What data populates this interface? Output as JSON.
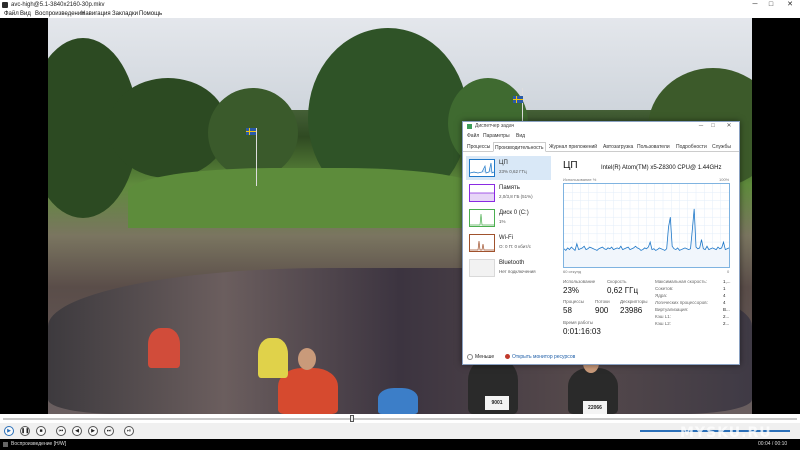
{
  "window": {
    "title": "avc-high@5.1-3840x2160-30p.mkv",
    "minimize_label": "─",
    "maximize_label": "□",
    "close_label": "✕"
  },
  "menu": {
    "items": [
      "Файл",
      "Вид",
      "Воспроизведение",
      "Навигация",
      "Закладки",
      "Помощь"
    ]
  },
  "video": {
    "bib_a": "9001",
    "bib_b": "22066"
  },
  "task_manager": {
    "title": "Диспетчер задач",
    "menu": [
      "Файл",
      "Параметры",
      "Вид"
    ],
    "tabs": [
      "Процессы",
      "Производительность",
      "Журнал приложений",
      "Автозагрузка",
      "Пользователи",
      "Подробности",
      "Службы"
    ],
    "active_tab": 1,
    "sidebar": [
      {
        "name": "ЦП",
        "sub": "23% 0,62 ГГц",
        "color": "#1f78c8"
      },
      {
        "name": "Память",
        "sub": "2,0/3,8 ГБ (51%)",
        "color": "#8a2be2"
      },
      {
        "name": "Диск 0 (C:)",
        "sub": "1%",
        "color": "#4caf50"
      },
      {
        "name": "Wi-Fi",
        "sub": "О: 0 П: 0 кбит/с",
        "color": "#a0522d"
      },
      {
        "name": "Bluetooth",
        "sub": "Нет подключения",
        "color": "#a0522d"
      }
    ],
    "cpu": {
      "heading": "ЦП",
      "model": "Intel(R) Atom(TM) x5-Z8300 CPU@ 1.44GHz",
      "util_label": "Использование %",
      "util_max": "100%",
      "time_label": "60 секунд",
      "time_zero": "0",
      "graph_color": "#1f78c8",
      "graph_values": [
        22,
        20,
        23,
        21,
        24,
        22,
        20,
        28,
        21,
        22,
        23,
        25,
        21,
        22,
        24,
        23,
        22,
        21,
        20,
        22,
        23,
        24,
        22,
        21,
        23,
        22,
        24,
        21,
        22,
        23,
        22,
        25,
        21,
        22,
        23,
        24,
        21,
        22,
        23,
        25,
        23,
        22,
        20,
        21,
        23,
        22,
        24,
        30,
        21,
        22,
        20,
        21,
        23,
        22,
        21,
        20,
        22,
        48,
        60,
        25,
        22,
        21,
        23,
        20,
        21,
        22,
        23,
        22,
        21,
        22,
        45,
        70,
        24,
        22,
        23,
        33,
        22,
        21,
        25,
        21,
        22,
        23,
        22,
        21,
        24,
        22,
        23,
        30,
        21,
        22,
        23
      ],
      "stats": [
        {
          "label": "Использование",
          "value": "23%"
        },
        {
          "label": "Скорость",
          "value": "0,62 ГГц"
        },
        {
          "label": "Процессы",
          "value": "58"
        },
        {
          "label": "Потоки",
          "value": "900"
        },
        {
          "label": "Дескрипторы",
          "value": "23986"
        },
        {
          "label": "Время работы",
          "value": "0:01:16:03"
        }
      ],
      "specs": [
        {
          "label": "Максимальная скорость:",
          "value": "1,..."
        },
        {
          "label": "Сокетов:",
          "value": "1"
        },
        {
          "label": "Ядра:",
          "value": "4"
        },
        {
          "label": "Логических процессоров:",
          "value": "4"
        },
        {
          "label": "Виртуализация:",
          "value": "В..."
        },
        {
          "label": "Кэш L1:",
          "value": "2..."
        },
        {
          "label": "Кэш L2:",
          "value": "2..."
        }
      ]
    },
    "footer": {
      "less": "Меньше",
      "monitor": "Открыть монитор ресурсов"
    }
  },
  "player": {
    "status": "Воспроизведение [H/W]",
    "time": "00:04 / 00:10",
    "progress": 0.44,
    "volume": 1.0,
    "watermark": "MYSKU.RU"
  }
}
